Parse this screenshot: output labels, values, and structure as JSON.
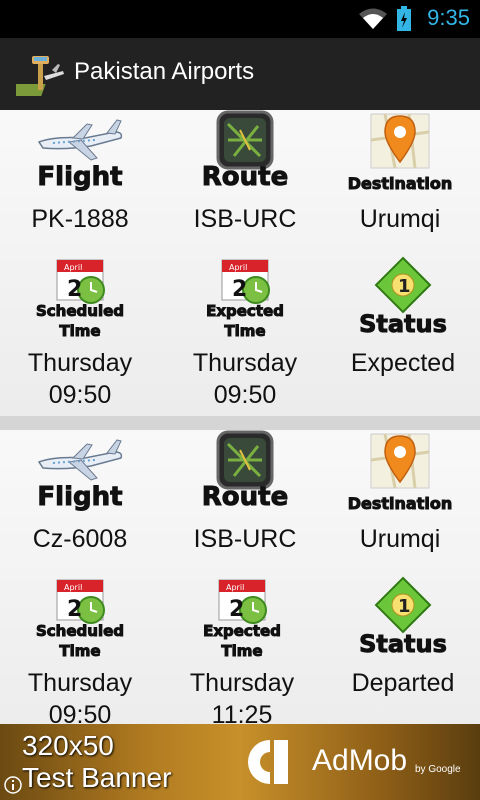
{
  "status_bar": {
    "time": "9:35"
  },
  "action_bar": {
    "title": "Pakistan Airports"
  },
  "labels": {
    "flight": "Flight",
    "route": "Route",
    "destination": "Destination",
    "scheduled_line1": "Scheduled",
    "scheduled_line2": "Time",
    "expected_line1": "Expected",
    "expected_line2": "Time",
    "status": "Status",
    "calendar_month": "April",
    "calendar_day": "2",
    "status_badge": "1"
  },
  "flights": [
    {
      "flight": "PK-1888",
      "route": "ISB-URC",
      "destination": "Urumqi",
      "scheduled_day": "Thursday",
      "scheduled_time": "09:50",
      "expected_day": "Thursday",
      "expected_time": "09:50",
      "status": "Expected"
    },
    {
      "flight": "Cz-6008",
      "route": "ISB-URC",
      "destination": "Urumqi",
      "scheduled_day": "Thursday",
      "scheduled_time": "09:50",
      "expected_day": "Thursday",
      "expected_time": "11:25",
      "status": "Departed"
    }
  ],
  "ad_banner": {
    "line1": "320x50",
    "line2": "Test Banner",
    "brand": "AdMob",
    "byline": "by Google"
  },
  "colors": {
    "status_time": "#33b5e5",
    "action_bar": "#222222",
    "divider": "#d5d5d5"
  }
}
